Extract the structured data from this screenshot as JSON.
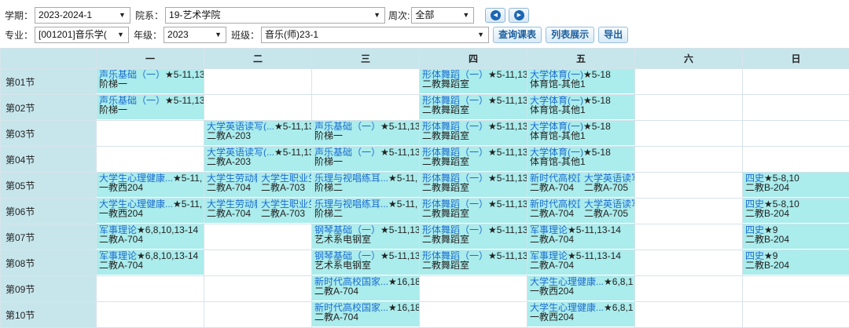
{
  "filters": {
    "term_label": "学期：",
    "term_value": "2023-2024-1",
    "dept_label": "院系：",
    "dept_value": "19-艺术学院",
    "week_label": "周次:",
    "week_value": "全部",
    "major_label": "专业：",
    "major_value": "[001201]音乐学(",
    "grade_label": "年级：",
    "grade_value": "2023",
    "class_label": "班级：",
    "class_value": "音乐(师)23-1"
  },
  "buttons": {
    "query": "查询课表",
    "list": "列表展示",
    "export": "导出"
  },
  "days": [
    "一",
    "二",
    "三",
    "四",
    "五",
    "六",
    "日"
  ],
  "rows": [
    {
      "label": "第01节",
      "cells": [
        [
          {
            "n": "声乐基础（一）",
            "w": "★5-11,13",
            "r": "阶梯一"
          }
        ],
        [],
        [],
        [
          {
            "n": "形体舞蹈（一）",
            "w": "★5-11,13",
            "r": "二教舞蹈室"
          }
        ],
        [
          {
            "n": "大学体育(一)",
            "w": "★5-18",
            "r": "体育馆-其他1"
          }
        ],
        [],
        []
      ]
    },
    {
      "label": "第02节",
      "cells": [
        [
          {
            "n": "声乐基础（一）",
            "w": "★5-11,13",
            "r": "阶梯一"
          }
        ],
        [],
        [],
        [
          {
            "n": "形体舞蹈（一）",
            "w": "★5-11,13",
            "r": "二教舞蹈室"
          }
        ],
        [
          {
            "n": "大学体育(一)",
            "w": "★5-18",
            "r": "体育馆-其他1"
          }
        ],
        [],
        []
      ]
    },
    {
      "label": "第03节",
      "cells": [
        [],
        [
          {
            "n": "大学英语读写(...",
            "w": "★5-11,13",
            "r": "二教A-203"
          }
        ],
        [
          {
            "n": "声乐基础（一）",
            "w": "★5-11,13",
            "r": "阶梯一"
          }
        ],
        [
          {
            "n": "形体舞蹈（一）",
            "w": "★5-11,13",
            "r": "二教舞蹈室"
          }
        ],
        [
          {
            "n": "大学体育(一)",
            "w": "★5-18",
            "r": "体育馆-其他1"
          }
        ],
        [],
        []
      ]
    },
    {
      "label": "第04节",
      "cells": [
        [],
        [
          {
            "n": "大学英语读写(...",
            "w": "★5-11,13",
            "r": "二教A-203"
          }
        ],
        [
          {
            "n": "声乐基础（一）",
            "w": "★5-11,13",
            "r": "阶梯一"
          }
        ],
        [
          {
            "n": "形体舞蹈（一）",
            "w": "★5-11,13",
            "r": "二教舞蹈室"
          }
        ],
        [
          {
            "n": "大学体育(一)",
            "w": "★5-18",
            "r": "体育馆-其他1"
          }
        ],
        [],
        []
      ]
    },
    {
      "label": "第05节",
      "cells": [
        [
          {
            "n": "大学生心理健康...",
            "w": "★5-11,",
            "r": "一教西204"
          }
        ],
        [
          {
            "n": "大学生劳动教",
            "w": "",
            "r": "二教A-704"
          },
          {
            "n": "大学生职业生",
            "w": "",
            "r": "二教A-703"
          }
        ],
        [
          {
            "n": "乐理与视唱练耳...",
            "w": "★5-11,",
            "r": "阶梯二"
          }
        ],
        [
          {
            "n": "形体舞蹈（一）",
            "w": "★5-11,13",
            "r": "二教舞蹈室"
          }
        ],
        [
          {
            "n": "新时代高校国",
            "w": "",
            "r": "二教A-704"
          },
          {
            "n": "大学英语读写",
            "w": "",
            "r": "二教A-705"
          }
        ],
        [],
        [
          {
            "n": "四史",
            "w": "★5-8,10",
            "r": "二教B-204"
          }
        ]
      ]
    },
    {
      "label": "第06节",
      "cells": [
        [
          {
            "n": "大学生心理健康...",
            "w": "★5-11,",
            "r": "一教西204"
          }
        ],
        [
          {
            "n": "大学生劳动教",
            "w": "",
            "r": "二教A-704"
          },
          {
            "n": "大学生职业生",
            "w": "",
            "r": "二教A-703"
          }
        ],
        [
          {
            "n": "乐理与视唱练耳...",
            "w": "★5-11,",
            "r": "阶梯二"
          }
        ],
        [
          {
            "n": "形体舞蹈（一）",
            "w": "★5-11,13",
            "r": "二教舞蹈室"
          }
        ],
        [
          {
            "n": "新时代高校国",
            "w": "",
            "r": "二教A-704"
          },
          {
            "n": "大学英语读写",
            "w": "",
            "r": "二教A-705"
          }
        ],
        [],
        [
          {
            "n": "四史",
            "w": "★5-8,10",
            "r": "二教B-204"
          }
        ]
      ]
    },
    {
      "label": "第07节",
      "cells": [
        [
          {
            "n": "军事理论",
            "w": "★6,8,10,13-14",
            "r": "二教A-704"
          }
        ],
        [],
        [
          {
            "n": "钢琴基础（一）",
            "w": "★5-11,13",
            "r": "艺术系电钢室"
          }
        ],
        [
          {
            "n": "形体舞蹈（一）",
            "w": "★5-11,13",
            "r": "二教舞蹈室"
          }
        ],
        [
          {
            "n": "军事理论",
            "w": "★5-11,13-14",
            "r": "二教A-704"
          }
        ],
        [],
        [
          {
            "n": "四史",
            "w": "★9",
            "r": "二教B-204"
          }
        ]
      ]
    },
    {
      "label": "第08节",
      "cells": [
        [
          {
            "n": "军事理论",
            "w": "★6,8,10,13-14",
            "r": "二教A-704"
          }
        ],
        [],
        [
          {
            "n": "钢琴基础（一）",
            "w": "★5-11,13",
            "r": "艺术系电钢室"
          }
        ],
        [
          {
            "n": "形体舞蹈（一）",
            "w": "★5-11,13",
            "r": "二教舞蹈室"
          }
        ],
        [
          {
            "n": "军事理论",
            "w": "★5-11,13-14",
            "r": "二教A-704"
          }
        ],
        [],
        [
          {
            "n": "四史",
            "w": "★9",
            "r": "二教B-204"
          }
        ]
      ]
    },
    {
      "label": "第09节",
      "cells": [
        [],
        [],
        [
          {
            "n": "新时代高校国家...",
            "w": "★16,18",
            "r": "二教A-704"
          }
        ],
        [],
        [
          {
            "n": "大学生心理健康...",
            "w": "★6,8,1",
            "r": "一教西204"
          }
        ],
        [],
        []
      ]
    },
    {
      "label": "第10节",
      "cells": [
        [],
        [],
        [
          {
            "n": "新时代高校国家...",
            "w": "★16,18",
            "r": "二教A-704"
          }
        ],
        [],
        [
          {
            "n": "大学生心理健康...",
            "w": "★6,8,1",
            "r": "一教西204"
          }
        ],
        [],
        []
      ]
    }
  ]
}
